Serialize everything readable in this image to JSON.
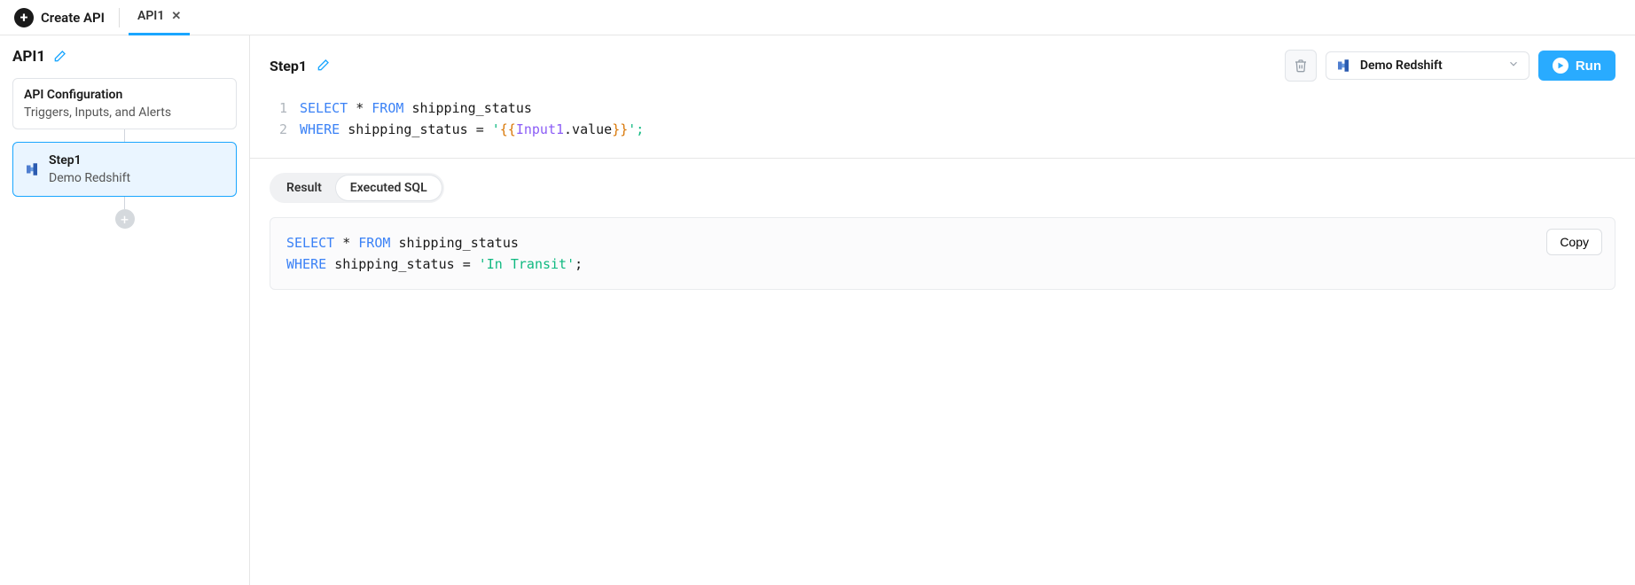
{
  "topbar": {
    "create_label": "Create API",
    "tabs": [
      {
        "label": "API1"
      }
    ]
  },
  "sidebar": {
    "api_name": "API1",
    "config_card": {
      "title": "API Configuration",
      "subtitle": "Triggers, Inputs, and Alerts"
    },
    "step_card": {
      "title": "Step1",
      "subtitle": "Demo Redshift"
    }
  },
  "step_header": {
    "title": "Step1",
    "datasource": "Demo Redshift",
    "run_label": "Run"
  },
  "code": {
    "lines": [
      {
        "num": "1"
      },
      {
        "num": "2"
      }
    ],
    "l1": {
      "select": "SELECT",
      "star": "*",
      "from": "FROM",
      "table": "shipping_status"
    },
    "l2": {
      "where": "WHERE",
      "col": "shipping_status",
      "eq": "=",
      "q1": "'",
      "open": "{{",
      "ref": "Input1",
      "dotval": ".value",
      "close": "}}",
      "q2": "';"
    }
  },
  "results": {
    "tabs": {
      "result": "Result",
      "executed": "Executed SQL"
    },
    "copy_label": "Copy",
    "exec": {
      "l1": {
        "select": "SELECT",
        "star": "*",
        "from": "FROM",
        "table": "shipping_status"
      },
      "l2": {
        "where": "WHERE",
        "col": "shipping_status",
        "eq": "=",
        "val": "'In Transit'",
        "semi": ";"
      }
    }
  }
}
